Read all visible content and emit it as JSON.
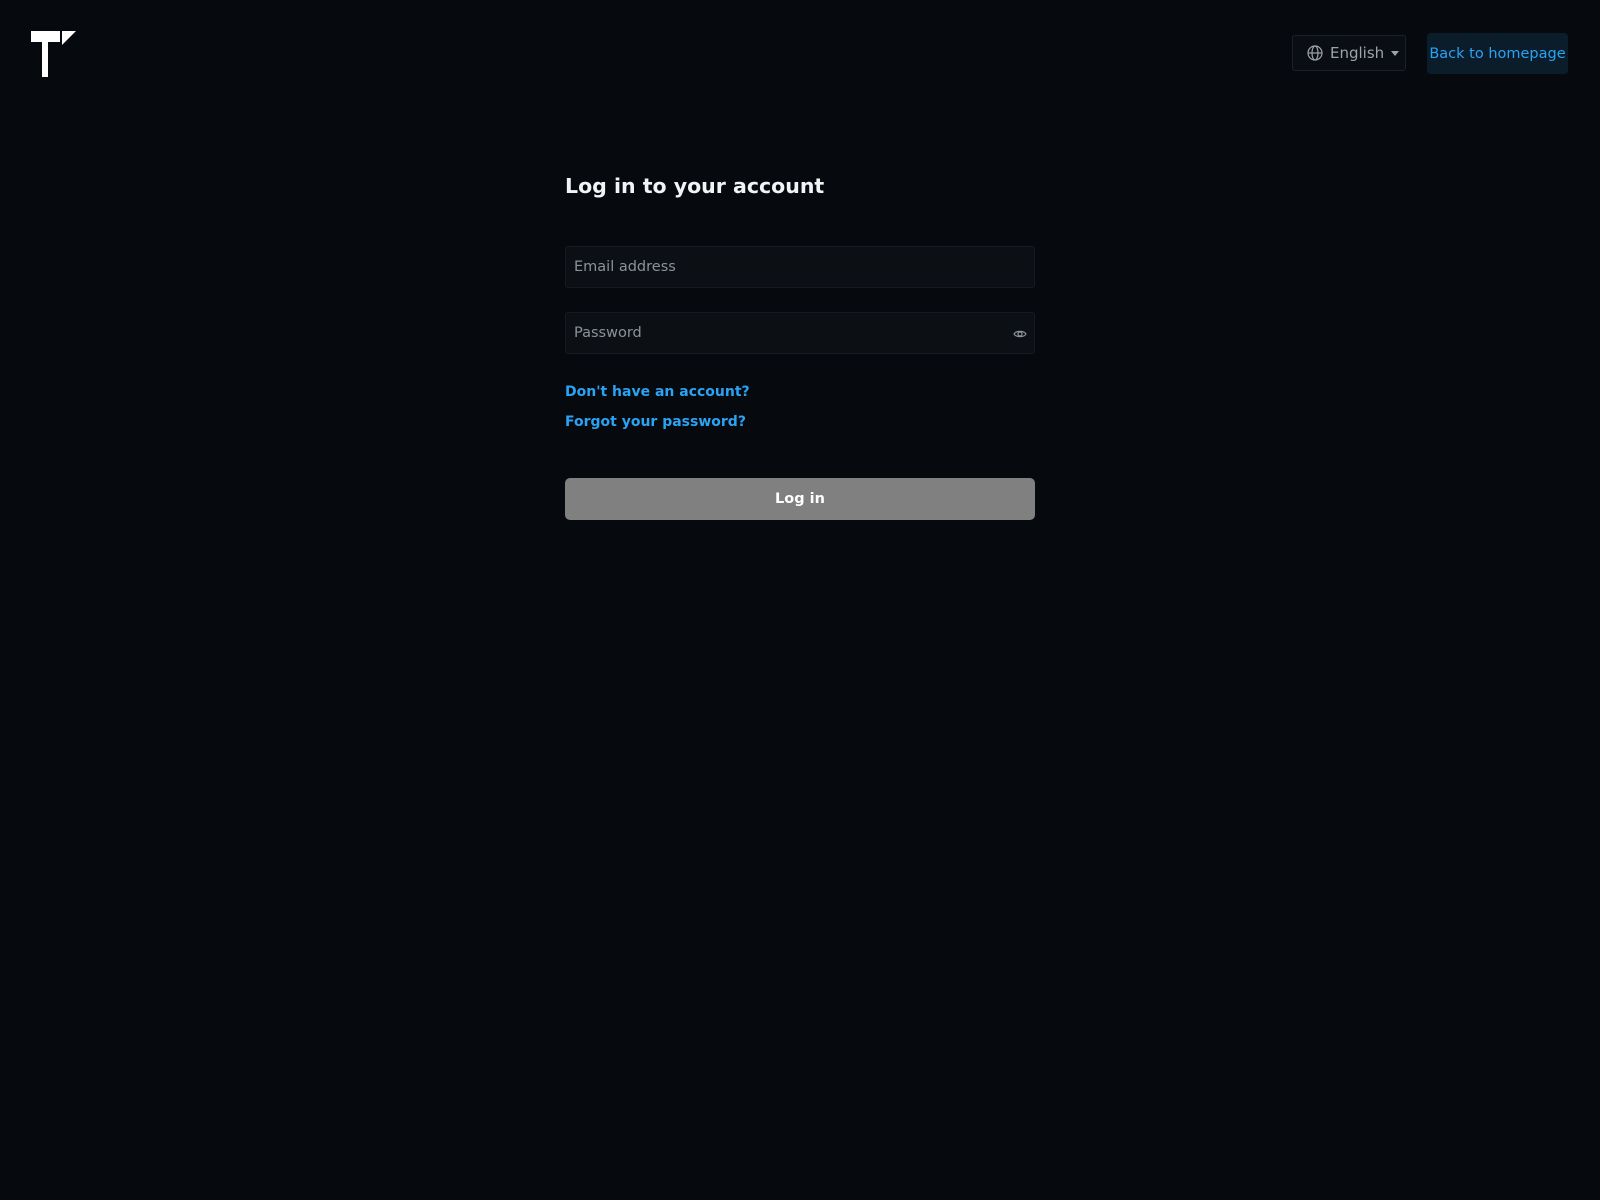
{
  "header": {
    "logo_icon": "brand-logo",
    "language": {
      "icon": "globe-icon",
      "selected": "English"
    },
    "back_label": "Back to homepage"
  },
  "login_form": {
    "title": "Log in to your account",
    "email": {
      "placeholder": "Email address",
      "value": ""
    },
    "password": {
      "placeholder": "Password",
      "value": "",
      "toggle_icon": "eye-icon"
    },
    "signup_link": "Don't have an account?",
    "forgot_link": "Forgot your password?",
    "submit_label": "Log in"
  },
  "colors": {
    "background": "#060a0e",
    "accent": "#2aa3f4",
    "button_disabled": "#808080"
  }
}
